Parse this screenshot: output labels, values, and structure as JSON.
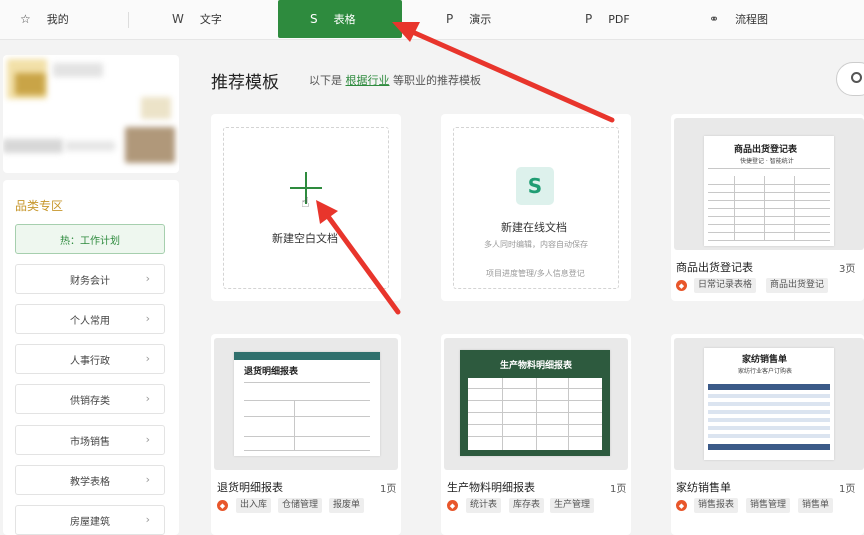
{
  "tabs": [
    {
      "icon": "☆",
      "label": "我的"
    },
    {
      "icon": "W",
      "label": "文字"
    },
    {
      "icon": "S",
      "label": "表格"
    },
    {
      "icon": "P",
      "label": "演示"
    },
    {
      "icon": "P",
      "label": "PDF"
    },
    {
      "icon": "⚭",
      "label": "流程图"
    }
  ],
  "categories": {
    "title": "品类专区",
    "hot": "热：工作计划",
    "items": [
      "财务会计",
      "个人常用",
      "人事行政",
      "供销存类",
      "市场销售",
      "教学表格",
      "房屋建筑"
    ]
  },
  "main": {
    "title": "推荐模板",
    "subtitle_before": "以下是",
    "subtitle_link": "根据行业",
    "subtitle_after": "等职业的推荐模板"
  },
  "new_blank": {
    "label": "新建空白文档"
  },
  "new_online": {
    "label": "新建在线文档",
    "desc": "多人同时编辑，内容自动保存",
    "hint": "项目进度管理/多人信息登记"
  },
  "templates": [
    {
      "name": "商品出货登记表",
      "pages": "3页",
      "tags": [
        "日常记录表格",
        "商品出货登记"
      ],
      "doc_title": "商品出货登记表",
      "doc_sub": "快捷登记 · 智能统计"
    },
    {
      "name": "退货明细报表",
      "pages": "1页",
      "tags": [
        "出入库",
        "仓储管理",
        "报废单"
      ],
      "doc_title": "退货明细报表"
    },
    {
      "name": "生产物料明细报表",
      "pages": "1页",
      "tags": [
        "统计表",
        "库存表",
        "生产管理"
      ],
      "doc_title": "生产物料明细报表"
    },
    {
      "name": "家纺销售单",
      "pages": "1页",
      "tags": [
        "销售报表",
        "销售管理",
        "销售单"
      ],
      "doc_title": "家纺销售单",
      "doc_sub": "家纺行业客户订购表"
    }
  ],
  "colors": {
    "accent": "#2e8b3e",
    "arrow": "#e8352c",
    "tag_icon": "#e8562a",
    "category_title": "#c7972c"
  }
}
